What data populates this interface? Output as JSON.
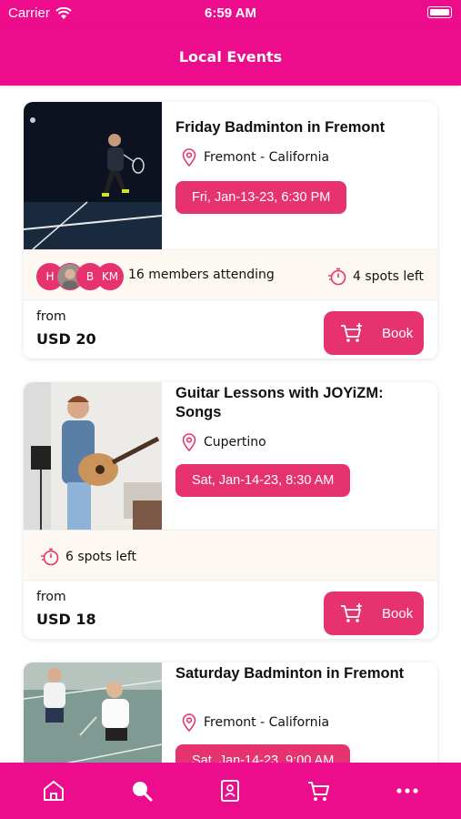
{
  "status_bar": {
    "carrier": "Carrier",
    "time": "6:59 AM"
  },
  "nav": {
    "title": "Local Events"
  },
  "events": [
    {
      "title": "Friday Badminton in Fremont",
      "location": "Fremont - California",
      "date": "Fri, Jan-13-23, 6:30 PM",
      "attendee_initials": [
        "H",
        "",
        "B",
        "KM"
      ],
      "attending_text": "16 members attending",
      "spots_text": "4 spots left",
      "from_label": "from",
      "price": "USD 20",
      "book_label": "Book"
    },
    {
      "title": "Guitar Lessons with JOYiZM: Songs",
      "location": "Cupertino",
      "date": "Sat, Jan-14-23, 8:30 AM",
      "spots_text": "6 spots left",
      "from_label": "from",
      "price": "USD 18",
      "book_label": "Book"
    },
    {
      "title": "Saturday Badminton  in Fremont",
      "location": "Fremont - California",
      "date": "Sat, Jan-14-23, 9:00 AM"
    }
  ],
  "tab_bar": {
    "tabs": [
      "home-icon",
      "search-icon",
      "profile-card-icon",
      "cart-icon",
      "more-icon"
    ]
  },
  "colors": {
    "brand": "#ec0c8c",
    "accent": "#e6336f",
    "info_row_bg": "#fdf8f1"
  }
}
